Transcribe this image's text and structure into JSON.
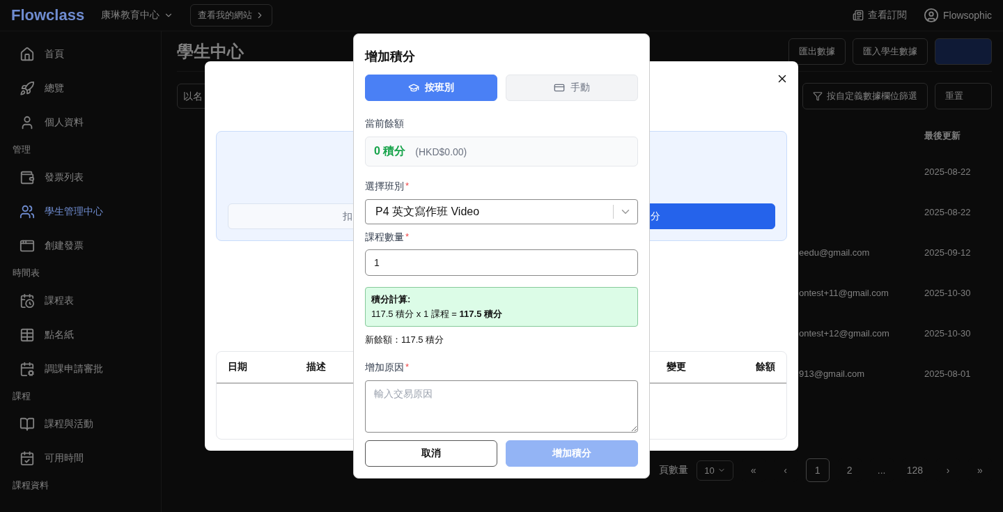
{
  "topbar": {
    "logo": "Flowclass",
    "org": "康琳教育中心",
    "site_button": "查看我的網站",
    "subscription": "查看訂閱",
    "user": "Flowsophic"
  },
  "sidebar": {
    "sections": [
      {
        "items": [
          {
            "label": "首頁",
            "selected": false
          },
          {
            "label": "總覽",
            "selected": false
          },
          {
            "label": "個人資料",
            "selected": false
          }
        ]
      },
      {
        "title": "管理",
        "items": [
          {
            "label": "發票列表",
            "selected": false
          },
          {
            "label": "學生管理中心",
            "selected": true
          },
          {
            "label": "創建發票",
            "selected": false
          }
        ]
      },
      {
        "title": "時間表",
        "items": [
          {
            "label": "課程表",
            "selected": false
          },
          {
            "label": "點名紙",
            "selected": false
          },
          {
            "label": "調課申請審批",
            "selected": false
          }
        ]
      },
      {
        "title": "課程",
        "items": [
          {
            "label": "課程與活動",
            "selected": false
          },
          {
            "label": "可用時間",
            "selected": false
          }
        ]
      },
      {
        "title": "課程資料"
      }
    ]
  },
  "page": {
    "title": "學生中心",
    "actions": [
      "匯出數據",
      "匯入學生數據"
    ],
    "search": {
      "placeholder": "以名"
    },
    "filter_button": "按自定義數據欄位篩選",
    "reset_button": "重置",
    "table": {
      "columns": [
        "最後更新"
      ],
      "rows": [
        {
          "updated": "2025-08-22"
        },
        {
          "updated": "2025-08-22"
        },
        {
          "email": "eedu@gmail.com",
          "updated": "2025-09-12"
        },
        {
          "email": "ontest+11@gmail.com",
          "updated": "2025-10-30"
        },
        {
          "email": "ontest+12@gmail.com",
          "updated": "2025-10-30"
        },
        {
          "email": "913@gmail.com",
          "updated": "2025-08-01"
        }
      ]
    },
    "pagination": {
      "page_size_label": "頁數量",
      "page_size": "10",
      "first": "«",
      "prev": "‹",
      "pages": [
        {
          "label": "1",
          "selected": true
        },
        {
          "label": "2",
          "selected": false
        },
        {
          "label": "...",
          "selected": false
        },
        {
          "label": "128",
          "selected": false
        }
      ],
      "next": "›",
      "last": "»"
    }
  },
  "points_dialog": {
    "panel_buttons": [
      "扣",
      "分"
    ],
    "history_table": {
      "columns": [
        "日期",
        "描述",
        "變更",
        "餘額"
      ]
    }
  },
  "add_points_dialog": {
    "title": "增加積分",
    "tabs": [
      {
        "label": "按班別",
        "selected": true
      },
      {
        "label": "手動",
        "selected": false
      }
    ],
    "balance": {
      "label": "當前餘額",
      "points": "0 積分",
      "money": "(HKD$0.00)"
    },
    "class_select": {
      "label": "選擇班別",
      "required_mark": "*",
      "value": "P4 英文寫作班 Video"
    },
    "quantity": {
      "label": "課程數量",
      "required_mark": "*",
      "value": "1"
    },
    "calculation": {
      "title": "積分計算:",
      "formula": "117.5 積分 x 1 課程 = **117.5 積分**"
    },
    "new_balance": "新餘額：117.5 積分",
    "reason": {
      "label": "增加原因",
      "required_mark": "*",
      "placeholder": "輸入交易原因"
    },
    "buttons": [
      {
        "label": "取消",
        "kind": "secondary",
        "disabled": false
      },
      {
        "label": "增加積分",
        "kind": "primary",
        "disabled": true
      }
    ]
  }
}
